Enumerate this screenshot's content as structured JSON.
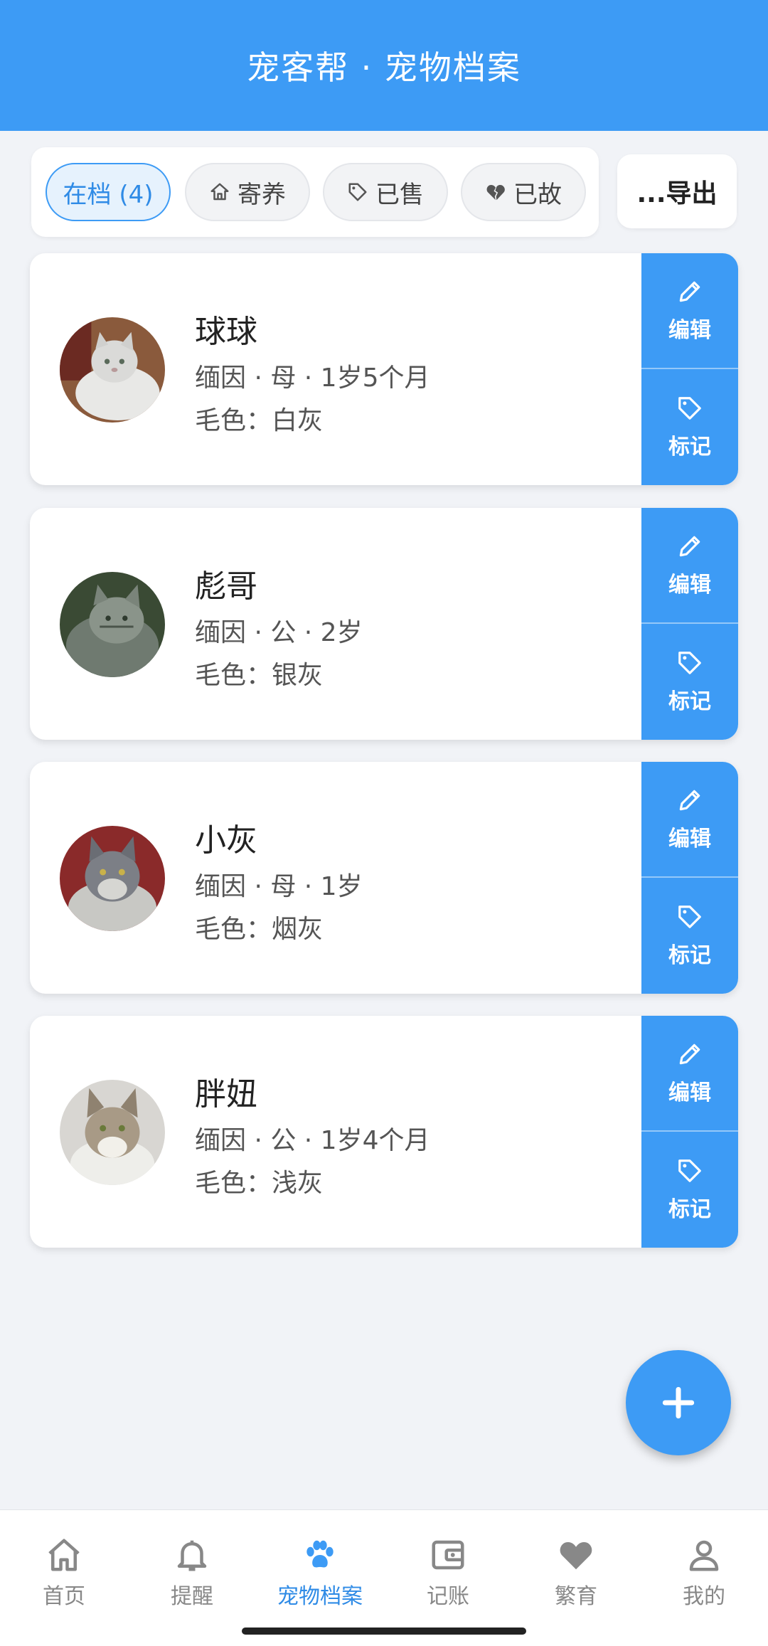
{
  "header": {
    "title": "宠客帮 · 宠物档案"
  },
  "filters": [
    {
      "label": "在档 (4)",
      "icon": "",
      "active": true
    },
    {
      "label": "寄养",
      "icon": "house-icon",
      "active": false
    },
    {
      "label": "已售",
      "icon": "tag-icon",
      "active": false
    },
    {
      "label": "已故",
      "icon": "broken-heart-icon",
      "active": false
    }
  ],
  "export_label": "...导出",
  "pets": [
    {
      "name": "球球",
      "meta": "缅因 · 母 · 1岁5个月",
      "coat": "毛色：白灰"
    },
    {
      "name": "彪哥",
      "meta": "缅因 · 公 · 2岁",
      "coat": "毛色：银灰"
    },
    {
      "name": "小灰",
      "meta": "缅因 · 母 · 1岁",
      "coat": "毛色：烟灰"
    },
    {
      "name": "胖妞",
      "meta": "缅因 · 公 · 1岁4个月",
      "coat": "毛色：浅灰"
    }
  ],
  "actions": {
    "edit": "编辑",
    "mark": "标记"
  },
  "nav": [
    {
      "label": "首页",
      "icon": "home-icon"
    },
    {
      "label": "提醒",
      "icon": "bell-icon"
    },
    {
      "label": "宠物档案",
      "icon": "paw-icon",
      "active": true
    },
    {
      "label": "记账",
      "icon": "wallet-icon"
    },
    {
      "label": "繁育",
      "icon": "heart-icon"
    },
    {
      "label": "我的",
      "icon": "person-icon"
    }
  ],
  "colors": {
    "primary": "#3d9bf5",
    "background": "#f1f3f7"
  }
}
